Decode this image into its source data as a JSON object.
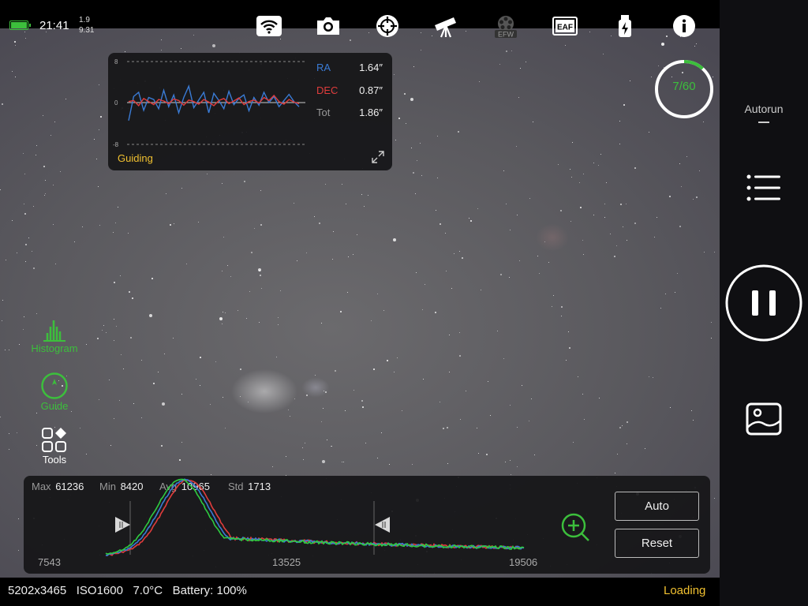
{
  "status": {
    "time": "21:41",
    "volt_top": "1.9",
    "volt_bottom": "9.31",
    "battery_fill_pct": 100
  },
  "top_icons": [
    "wifi-icon",
    "camera-icon",
    "focus-target-icon",
    "telescope-icon",
    "efw-icon",
    "eaf-icon",
    "usb-power-icon",
    "info-icon"
  ],
  "top_icon_text": {
    "efw": "EFW",
    "eaf": "EAF"
  },
  "guiding": {
    "title": "Guiding",
    "y_max_label": "8",
    "y_zero_label": "0",
    "y_min_label": "-8",
    "ra_label": "RA",
    "ra_value": "1.64″",
    "dec_label": "DEC",
    "dec_value": "0.87″",
    "tot_label": "Tot",
    "tot_value": "1.86″",
    "ra_color": "#3a7bd5",
    "dec_color": "#e03c3c",
    "ra_series": [
      -3.5,
      1.2,
      2.0,
      -1.5,
      1.0,
      0.6,
      -1.2,
      2.4,
      -0.8,
      1.5,
      -2.0,
      1.0,
      3.2,
      -1.0,
      0.5,
      2.0,
      -2.0,
      1.8,
      0.4,
      -1.2,
      2.2,
      -0.4,
      0.8,
      1.5,
      -1.6,
      1.0,
      -0.5,
      2.0,
      0.0,
      1.2,
      -0.8,
      0.4,
      1.6,
      0.2,
      -0.8
    ],
    "dec_series": [
      0.2,
      0.4,
      -0.6,
      0.8,
      0.2,
      -0.4,
      0.6,
      0.3,
      -0.2,
      0.7,
      0.4,
      -0.5,
      0.5,
      0.2,
      -0.3,
      0.6,
      0.1,
      -0.6,
      0.4,
      0.8,
      -0.2,
      0.3,
      0.9,
      -0.4,
      0.2,
      0.5,
      -0.1,
      1.0,
      0.4,
      1.4,
      0.2,
      -0.3,
      0.6,
      0.1,
      -0.2
    ]
  },
  "autorun": {
    "progress_label": "7/60",
    "progress_done": 7,
    "progress_total": 60,
    "label": "Autorun",
    "accent": "#3cbf3c"
  },
  "right_buttons": [
    "list-icon",
    "pause-icon",
    "gallery-icon"
  ],
  "side_tools": {
    "histogram_label": "Histogram",
    "guide_label": "Guide",
    "tools_label": "Tools"
  },
  "histogram": {
    "max_label": "Max",
    "max_value": "61236",
    "min_label": "Min",
    "min_value": "8420",
    "avg_label": "Avg",
    "avg_value": "10965",
    "std_label": "Std",
    "std_value": "1713",
    "axis_left": "7543",
    "axis_mid": "13525",
    "axis_right": "19506",
    "auto_label": "Auto",
    "reset_label": "Reset",
    "channels": [
      "#2ecc40",
      "#3a7bd5",
      "#e03c3c"
    ],
    "black_point": 8420,
    "white_point": 15300
  },
  "bottom": {
    "info": "5202x3465   ISO1600   7.0°C   Battery: 100%",
    "loading": "Loading"
  }
}
